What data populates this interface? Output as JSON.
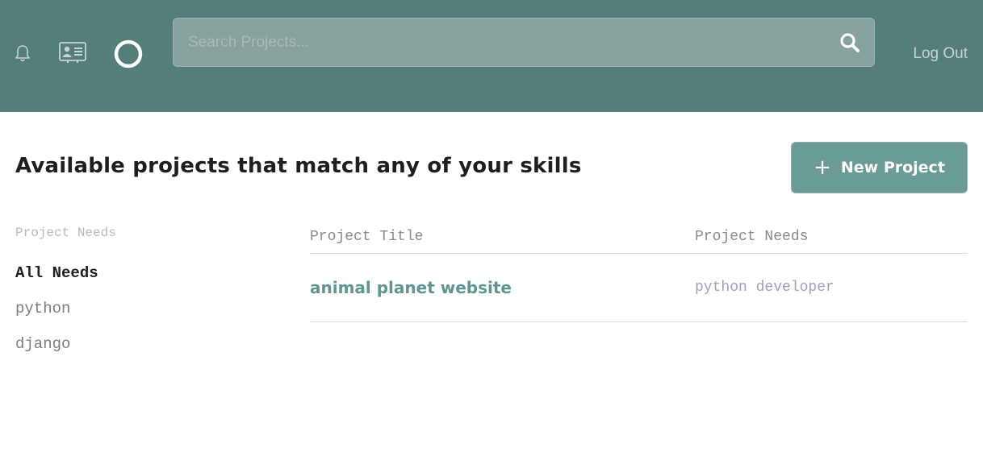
{
  "header": {
    "search_placeholder": "Search Projects...",
    "logout_label": "Log Out"
  },
  "main": {
    "title": "Available projects that match any of your skills",
    "new_project_label": "New Project",
    "plus_glyph": "+"
  },
  "filters": {
    "heading": "Project Needs",
    "items": [
      {
        "label": "All Needs"
      },
      {
        "label": "python"
      },
      {
        "label": "django"
      }
    ]
  },
  "table": {
    "columns": [
      "Project Title",
      "Project Needs"
    ],
    "rows": [
      {
        "title": "animal planet website",
        "needs": "python developer"
      }
    ]
  },
  "colors": {
    "header_bg": "#537e79",
    "accent": "#6b9b95",
    "link": "#5f9590",
    "tag": "#a99bbd"
  }
}
